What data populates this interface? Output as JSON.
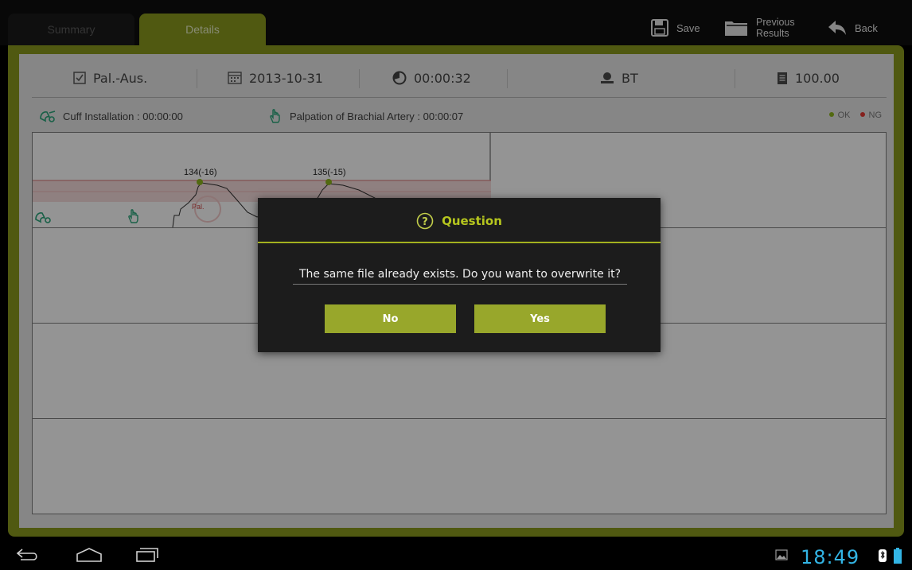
{
  "tabs": [
    {
      "label": "Summary",
      "active": false
    },
    {
      "label": "Details",
      "active": true
    }
  ],
  "toolbar": {
    "save_label": "Save",
    "previous_label_line1": "Previous",
    "previous_label_line2": "Results",
    "back_label": "Back"
  },
  "info": {
    "mode": "Pal.-Aus.",
    "date": "2013-10-31",
    "duration": "00:00:32",
    "user": "BT",
    "score": "100.00"
  },
  "phases": {
    "cuff": "Cuff Installation : 00:00:00",
    "palpation": "Palpation of Brachial Artery : 00:00:07"
  },
  "legend": {
    "ok_label": "OK",
    "ng_label": "NG",
    "ok_color": "#8db51c",
    "ng_color": "#e53935"
  },
  "chart": {
    "marker1_label": "134(-16)",
    "marker2_label": "135(-15)",
    "pal_label": "Pal."
  },
  "dialog": {
    "title": "Question",
    "message": "The same file already exists. Do you want to overwrite it?",
    "no_label": "No",
    "yes_label": "Yes"
  },
  "status": {
    "time": "18:49"
  },
  "colors": {
    "accent": "#8a9a1e",
    "dialog_title": "#b6c61e",
    "clock": "#33b5e5"
  }
}
